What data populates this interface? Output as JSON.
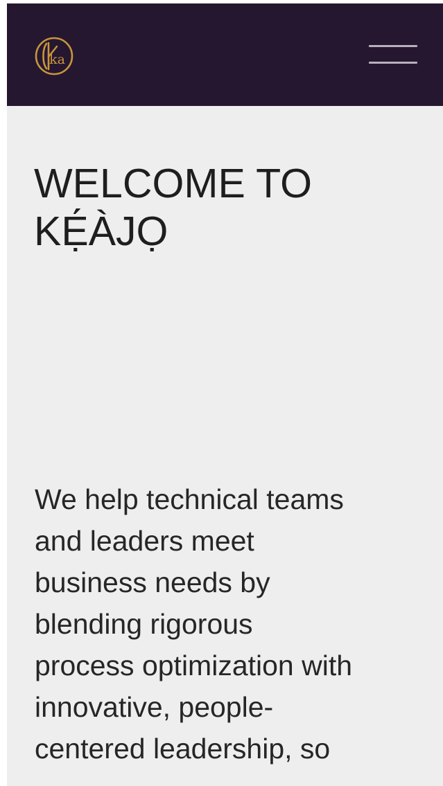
{
  "header": {
    "logo_alt": "KÉÀJỌ logo",
    "logo_letters": "ka",
    "menu_label": "Menu",
    "colors": {
      "background": "#261730",
      "logo_gold": "#c8963c",
      "menu_bars": "#b7b0bd"
    }
  },
  "hero": {
    "title_lines": [
      "WELCOME TO",
      "KẸ́ÀJỌ"
    ],
    "intro_lines": [
      "We help technical teams",
      "and leaders meet",
      "business needs by",
      "blending rigorous",
      "process optimization with",
      "innovative, people-",
      "centered leadership, so"
    ]
  },
  "colors": {
    "page_background": "#eeeeee",
    "text": "#1e1e1e"
  }
}
